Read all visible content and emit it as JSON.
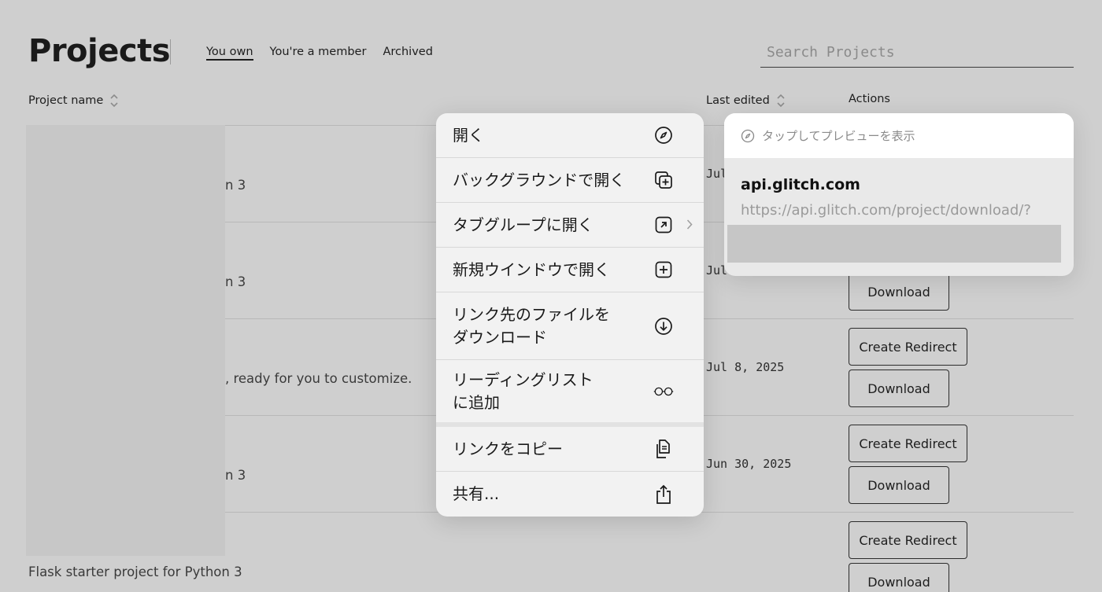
{
  "header": {
    "title": "Projects",
    "tabs": [
      {
        "label": "You own",
        "active": true
      },
      {
        "label": "You're a member",
        "active": false
      },
      {
        "label": "Archived",
        "active": false
      }
    ],
    "search_placeholder": "Search Projects"
  },
  "table": {
    "columns": {
      "project_name": "Project name",
      "last_edited": "Last edited",
      "actions": "Actions"
    },
    "rows": [
      {
        "description": "n 3",
        "date": "Jul"
      },
      {
        "description": "n 3",
        "date": "Jul",
        "download": "Download"
      },
      {
        "description": ", ready for you to customize.",
        "date": "Jul 8, 2025",
        "create_redirect": "Create Redirect",
        "download": "Download"
      },
      {
        "description": "n 3",
        "date": "Jun 30, 2025",
        "create_redirect": "Create Redirect",
        "download": "Download"
      },
      {
        "description": "Flask starter project for Python 3",
        "create_redirect": "Create Redirect",
        "download": "Download"
      }
    ]
  },
  "context_menu": {
    "items": [
      {
        "label": "開く",
        "icon": "compass-icon"
      },
      {
        "label": "バックグラウンドで開く",
        "icon": "open-background-icon"
      },
      {
        "label": "タブグループに開く",
        "icon": "tab-group-icon"
      },
      {
        "label": "新規ウインドウで開く",
        "icon": "new-window-icon"
      },
      {
        "label": "リンク先のファイルを\nダウンロード",
        "icon": "download-icon"
      },
      {
        "label": "リーディングリスト\nに追加",
        "icon": "reading-glasses-icon"
      },
      {
        "label": "リンクをコピー",
        "icon": "copy-icon"
      },
      {
        "label": "共有...",
        "icon": "share-icon"
      }
    ]
  },
  "preview": {
    "hint": "タップしてプレビューを表示",
    "domain": "api.glitch.com",
    "url": "https://api.glitch.com/project/download/?"
  },
  "colors": {
    "background": "#cfcfcf",
    "menu_background": "#f2f2f2",
    "text": "#1d1d1d"
  }
}
